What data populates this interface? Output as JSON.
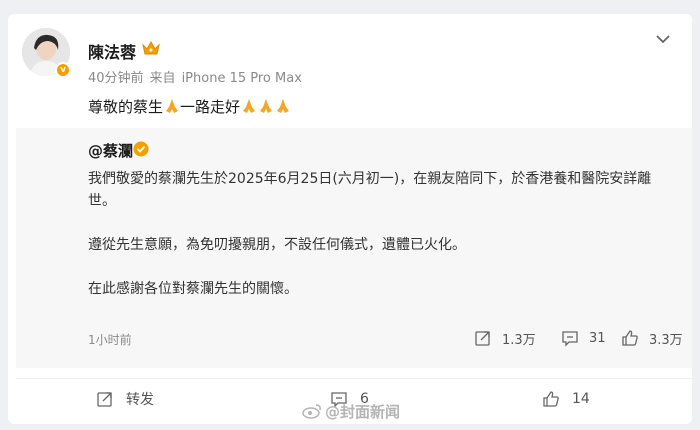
{
  "post": {
    "author": "陳法蓉",
    "meta": {
      "time": "40分钟前",
      "source_prefix": "来自",
      "device": "iPhone 15 Pro Max"
    },
    "text": "尊敬的蔡生",
    "text_mid": "一路走好"
  },
  "repost": {
    "author": "@蔡瀾",
    "paragraphs": [
      "我們敬愛的蔡瀾先生於2025年6月25日(六月初一)，在親友陪同下，於香港養和醫院安詳離世。",
      "遵從先生意願，為免叨擾親朋，不設任何儀式，遺體已火化。",
      "在此感謝各位對蔡瀾先生的關懷。"
    ],
    "time": "1小时前",
    "stats": {
      "reposts": "1.3万",
      "comments": "31",
      "likes": "3.3万"
    }
  },
  "actions": {
    "repost": "转发",
    "comment": "6",
    "like": "14"
  },
  "watermark": {
    "text": "@封面新闻"
  },
  "icons": [
    "crown-icon",
    "verified-icon",
    "pray-icon",
    "chevron-down-icon",
    "share-icon",
    "comment-icon",
    "like-icon",
    "weibo-logo-icon"
  ],
  "colors": {
    "accent": "#f5a000",
    "text": "#1c1c1c",
    "muted": "#8a8a8a",
    "repost_bg": "#f7f7f7"
  }
}
